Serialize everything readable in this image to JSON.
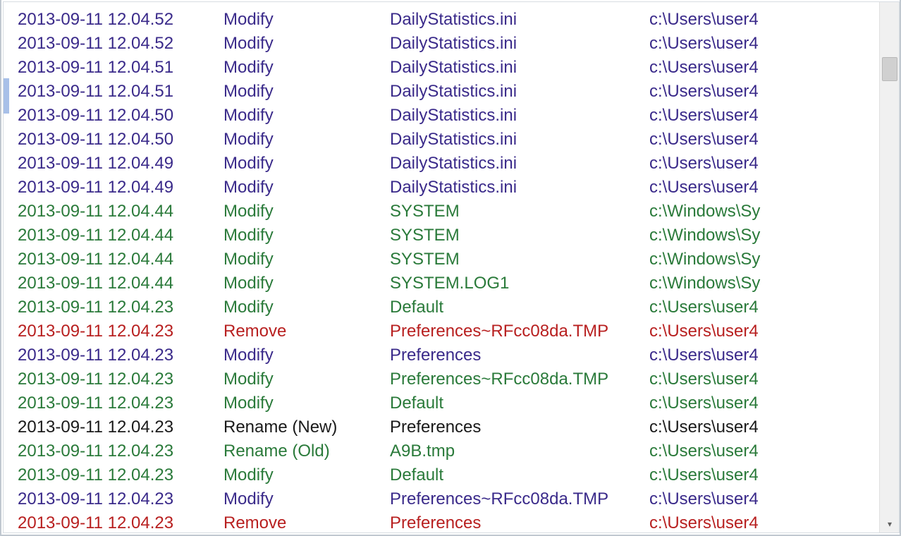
{
  "rows": [
    {
      "time": "2013-09-11 12.04.52",
      "action": "Modify",
      "file": "DailyStatistics.ini",
      "path": "c:\\Users\\user4",
      "color": "purple"
    },
    {
      "time": "2013-09-11 12.04.52",
      "action": "Modify",
      "file": "DailyStatistics.ini",
      "path": "c:\\Users\\user4",
      "color": "purple"
    },
    {
      "time": "2013-09-11 12.04.51",
      "action": "Modify",
      "file": "DailyStatistics.ini",
      "path": "c:\\Users\\user4",
      "color": "purple"
    },
    {
      "time": "2013-09-11 12.04.51",
      "action": "Modify",
      "file": "DailyStatistics.ini",
      "path": "c:\\Users\\user4",
      "color": "purple"
    },
    {
      "time": "2013-09-11 12.04.50",
      "action": "Modify",
      "file": "DailyStatistics.ini",
      "path": "c:\\Users\\user4",
      "color": "purple"
    },
    {
      "time": "2013-09-11 12.04.50",
      "action": "Modify",
      "file": "DailyStatistics.ini",
      "path": "c:\\Users\\user4",
      "color": "purple"
    },
    {
      "time": "2013-09-11 12.04.49",
      "action": "Modify",
      "file": "DailyStatistics.ini",
      "path": "c:\\Users\\user4",
      "color": "purple"
    },
    {
      "time": "2013-09-11 12.04.49",
      "action": "Modify",
      "file": "DailyStatistics.ini",
      "path": "c:\\Users\\user4",
      "color": "purple"
    },
    {
      "time": "2013-09-11 12.04.44",
      "action": "Modify",
      "file": "SYSTEM",
      "path": "c:\\Windows\\Sy",
      "color": "green"
    },
    {
      "time": "2013-09-11 12.04.44",
      "action": "Modify",
      "file": "SYSTEM",
      "path": "c:\\Windows\\Sy",
      "color": "green"
    },
    {
      "time": "2013-09-11 12.04.44",
      "action": "Modify",
      "file": "SYSTEM",
      "path": "c:\\Windows\\Sy",
      "color": "green"
    },
    {
      "time": "2013-09-11 12.04.44",
      "action": "Modify",
      "file": "SYSTEM.LOG1",
      "path": "c:\\Windows\\Sy",
      "color": "green"
    },
    {
      "time": "2013-09-11 12.04.23",
      "action": "Modify",
      "file": "Default",
      "path": "c:\\Users\\user4",
      "color": "green"
    },
    {
      "time": "2013-09-11 12.04.23",
      "action": "Remove",
      "file": "Preferences~RFcc08da.TMP",
      "path": "c:\\Users\\user4",
      "color": "red"
    },
    {
      "time": "2013-09-11 12.04.23",
      "action": "Modify",
      "file": "Preferences",
      "path": "c:\\Users\\user4",
      "color": "purple"
    },
    {
      "time": "2013-09-11 12.04.23",
      "action": "Modify",
      "file": "Preferences~RFcc08da.TMP",
      "path": "c:\\Users\\user4",
      "color": "green"
    },
    {
      "time": "2013-09-11 12.04.23",
      "action": "Modify",
      "file": "Default",
      "path": "c:\\Users\\user4",
      "color": "green"
    },
    {
      "time": "2013-09-11 12.04.23",
      "action": "Rename (New)",
      "file": "Preferences",
      "path": "c:\\Users\\user4",
      "color": "black"
    },
    {
      "time": "2013-09-11 12.04.23",
      "action": "Rename (Old)",
      "file": "A9B.tmp",
      "path": "c:\\Users\\user4",
      "color": "green"
    },
    {
      "time": "2013-09-11 12.04.23",
      "action": "Modify",
      "file": "Default",
      "path": "c:\\Users\\user4",
      "color": "green"
    },
    {
      "time": "2013-09-11 12.04.23",
      "action": "Modify",
      "file": "Preferences~RFcc08da.TMP",
      "path": "c:\\Users\\user4",
      "color": "purple"
    },
    {
      "time": "2013-09-11 12.04.23",
      "action": "Remove",
      "file": "Preferences",
      "path": "c:\\Users\\user4",
      "color": "red"
    }
  ],
  "colors": {
    "purple": "c-purple",
    "green": "c-green",
    "red": "c-red",
    "black": "c-black"
  }
}
